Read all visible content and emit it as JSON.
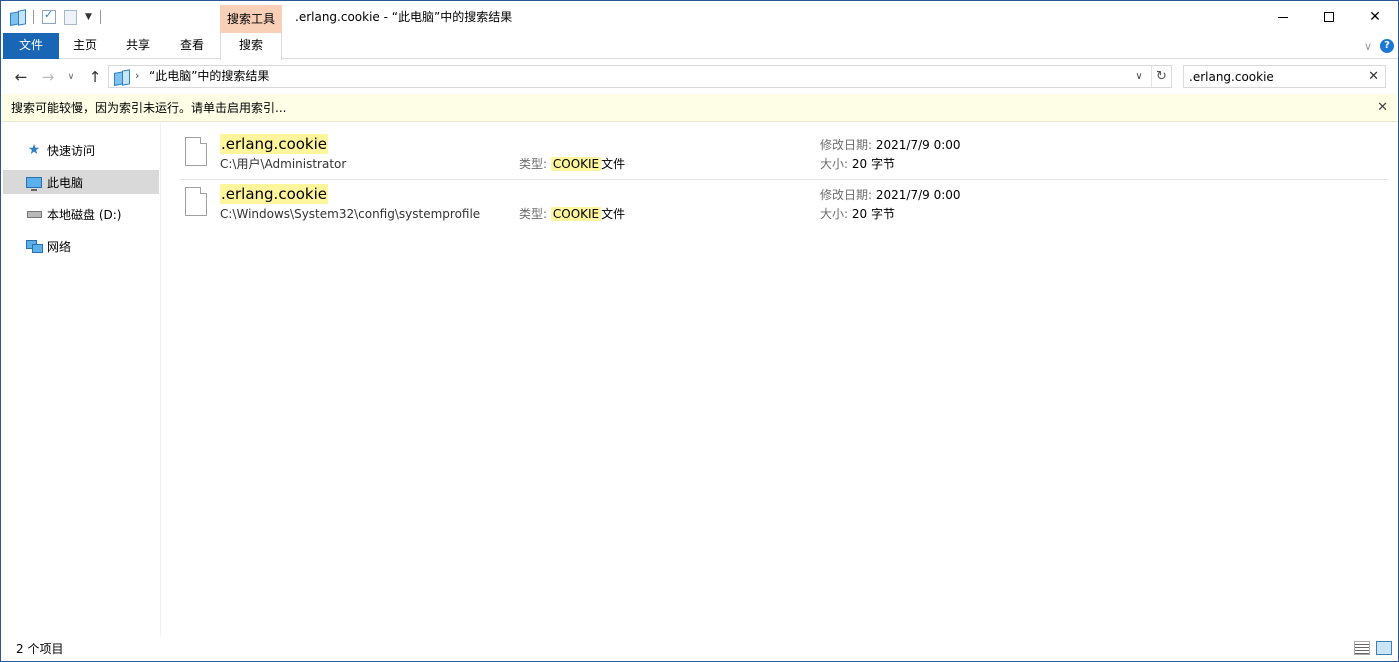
{
  "title_bar": {
    "title": ".erlang.cookie - “此电脑”中的搜索结果",
    "contextual_group": "搜索工具"
  },
  "ribbon": {
    "tabs": [
      {
        "label": "文件"
      },
      {
        "label": "主页"
      },
      {
        "label": "共享"
      },
      {
        "label": "查看"
      },
      {
        "label": "搜索"
      }
    ],
    "help_label": "?"
  },
  "address_bar": {
    "breadcrumb": "“此电脑”中的搜索结果"
  },
  "search": {
    "value": ".erlang.cookie"
  },
  "info_bar": {
    "message": "搜索可能较慢，因为索引未运行。请单击启用索引..."
  },
  "nav_pane": {
    "items": [
      {
        "label": "快速访问",
        "icon": "star-icon"
      },
      {
        "label": "此电脑",
        "icon": "computer-icon",
        "selected": true
      },
      {
        "label": "本地磁盘 (D:)",
        "icon": "drive-icon"
      },
      {
        "label": "网络",
        "icon": "network-icon"
      }
    ]
  },
  "results": [
    {
      "name": ".erlang.cookie",
      "path": "C:\\用户\\Administrator",
      "type_label": "类型:",
      "type_highlight": "COOKIE",
      "type_suffix": "文件",
      "date_label": "修改日期:",
      "date_value": "2021/7/9 0:00",
      "size_label": "大小:",
      "size_value": "20 字节"
    },
    {
      "name": ".erlang.cookie",
      "path": "C:\\Windows\\System32\\config\\systemprofile",
      "type_label": "类型:",
      "type_highlight": "COOKIE",
      "type_suffix": "文件",
      "date_label": "修改日期:",
      "date_value": "2021/7/9 0:00",
      "size_label": "大小:",
      "size_value": "20 字节"
    }
  ],
  "status_bar": {
    "item_count": "2 个项目"
  },
  "colors": {
    "file_tab": "#1966b7",
    "contextual_tab": "#f8d0b8",
    "highlight": "#fff59d",
    "info_bar": "#fefee7",
    "selected_nav": "#d9d9d9"
  }
}
